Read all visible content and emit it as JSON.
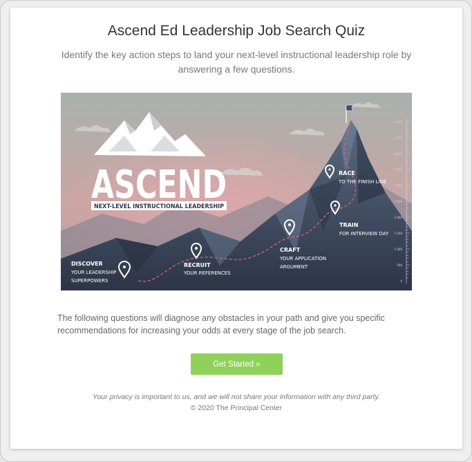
{
  "quiz": {
    "title": "Ascend Ed Leadership Job Search Quiz",
    "subtitle": "Identify the key action steps to land your next-level instructional leadership role by answering a few questions.",
    "description": "The following questions will diagnose any obstacles in your path and give you specific recommendations for increasing your odds at every stage of the job search.",
    "cta_label": "Get Started »",
    "privacy_note": "Your privacy is important to us, and we will not share your information with any third party.",
    "copyright": "© 2020 The Principal Center"
  },
  "hero": {
    "brand_word": "ASCEND",
    "tagline": "NEXT-LEVEL INSTRUCTIONAL LEADERSHIP",
    "steps": [
      {
        "title": "DISCOVER",
        "line1": "YOUR LEADERSHIP",
        "line2": "SUPERPOWERS"
      },
      {
        "title": "RECRUIT",
        "line1": "YOUR REFERENCES",
        "line2": ""
      },
      {
        "title": "CRAFT",
        "line1": "YOUR APPLICATION",
        "line2": "ARGUMENT"
      },
      {
        "title": "TRAIN",
        "line1": "FOR INTERVIEW DAY",
        "line2": ""
      },
      {
        "title": "RACE",
        "line1": "TO THE FINISH LINE",
        "line2": ""
      }
    ],
    "scale_labels": [
      "5 000",
      "4 500",
      "4 000",
      "3 500",
      "3 000",
      "2 500",
      "2 000",
      "1 500",
      "1 000",
      "500",
      "0"
    ]
  },
  "colors": {
    "accent_green": "#8fd15a",
    "title_text": "#333333",
    "body_text": "#777777",
    "trail_pink": "#e0607e"
  }
}
